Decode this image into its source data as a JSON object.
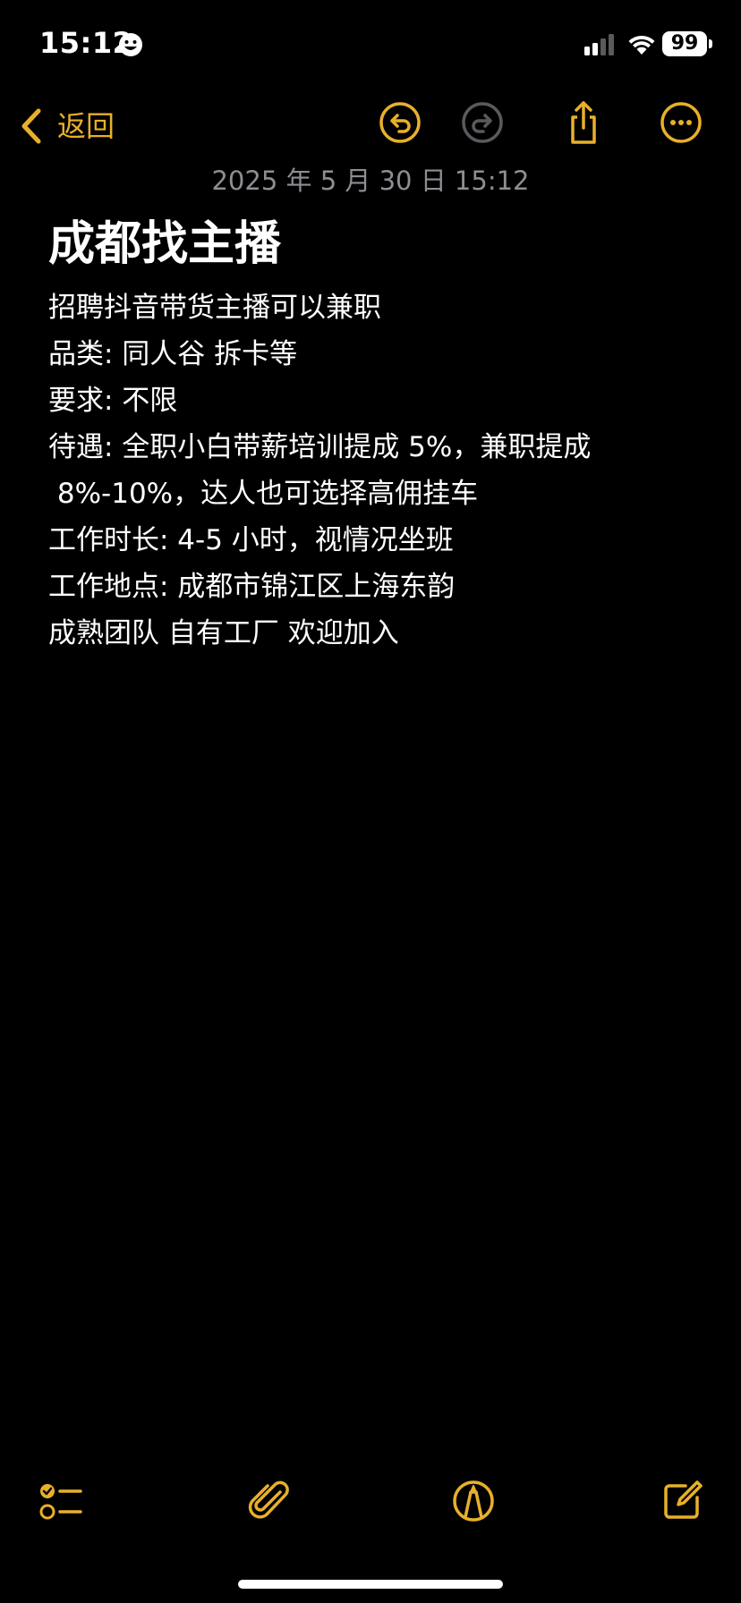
{
  "status_bar": {
    "time": "15:12",
    "battery": "99"
  },
  "nav": {
    "back_label": "返回"
  },
  "note": {
    "date": "2025 年 5 月 30 日 15:12",
    "title": "成都找主播",
    "lines": [
      "招聘抖音带货主播可以兼职",
      "品类: 同人谷 拆卡等",
      "要求: 不限",
      "待遇: 全职小白带薪培训提成 5%，兼职提成",
      " 8%-10%，达人也可选择高佣挂车",
      "工作时长: 4-5 小时，视情况坐班",
      "工作地点: 成都市锦江区上海东韵",
      "成熟团队 自有工厂 欢迎加入"
    ]
  },
  "colors": {
    "accent": "#e8b02a",
    "disabled": "#5a5a5e",
    "date_text": "#8e8e93",
    "background": "#000000"
  },
  "icons": {
    "undo": "undo-icon",
    "redo": "redo-icon",
    "share": "share-icon",
    "more": "more-icon",
    "checklist": "checklist-icon",
    "attachment": "paperclip-icon",
    "markup": "markup-pen-icon",
    "compose": "compose-icon"
  }
}
